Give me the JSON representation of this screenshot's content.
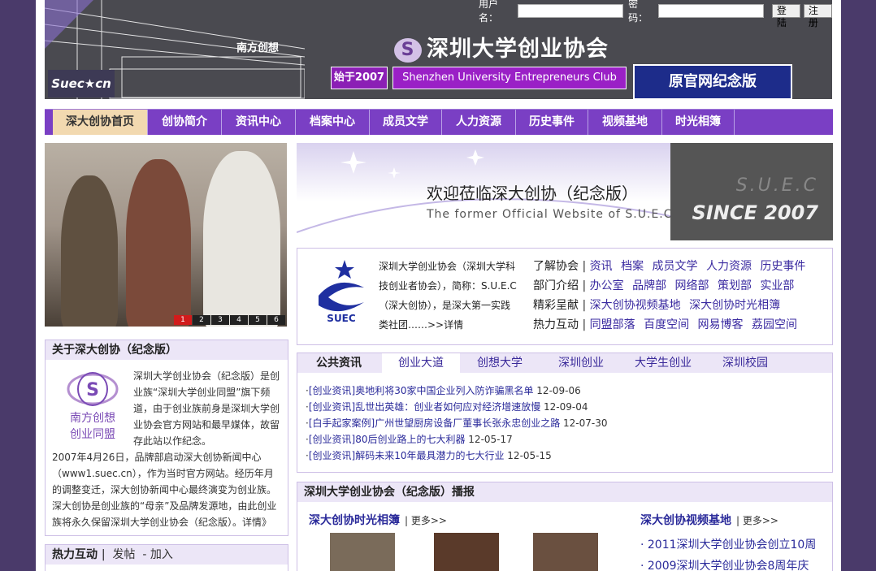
{
  "header": {
    "login_user_label": "用户名：",
    "login_pass_label": "密码：",
    "login_button": "登陆",
    "register_button": "注册",
    "logo_text": "Suec★cn",
    "nanfang_label": "南方创想",
    "site_title": "深圳大学创业协会",
    "since_badge": "始于2007",
    "subtitle_en": "Shenzhen University Entrepreneurs Club",
    "memorial_badge": "原官网纪念版"
  },
  "nav": [
    {
      "label": "深大创协首页",
      "active": true
    },
    {
      "label": "创协简介"
    },
    {
      "label": "资讯中心"
    },
    {
      "label": "档案中心"
    },
    {
      "label": "成员文学"
    },
    {
      "label": "人力资源"
    },
    {
      "label": "历史事件"
    },
    {
      "label": "视频基地"
    },
    {
      "label": "时光相簿"
    }
  ],
  "slideshow": {
    "pages": [
      "1",
      "2",
      "3",
      "4",
      "5",
      "6"
    ],
    "active": "1"
  },
  "banner": {
    "title": "欢迎莅临深大创协（纪念版）",
    "subtitle_en": "The former Official Website of S.U.E.C",
    "suec": "S.U.E.C",
    "since": "SINCE 2007"
  },
  "intro": {
    "text": "深圳大学创业协会（深圳大学科技创业者协会），简称：S.U.E.C（深大创协），是深大第一实践类社团……>>详情",
    "rows": [
      {
        "label": "了解协会",
        "links": [
          "资讯",
          "档案",
          "成员文学",
          "人力资源",
          "历史事件"
        ]
      },
      {
        "label": "部门介绍",
        "links": [
          "办公室",
          "品牌部",
          "网络部",
          "策划部",
          "实业部"
        ]
      },
      {
        "label": "精彩呈献",
        "links": [
          "深大创协视频基地",
          "深大创协时光相簿"
        ]
      },
      {
        "label": "热力互动",
        "links": [
          "同盟部落",
          "百度空间",
          "网易博客",
          "荔园空间"
        ]
      }
    ]
  },
  "news": {
    "tabs": [
      "公共资讯",
      "创业大道",
      "创想大学",
      "深圳创业",
      "大学生创业",
      "深圳校园"
    ],
    "active_tab": "创业大道",
    "items": [
      {
        "title": "[创业资讯]奥地利将30家中国企业列入防诈骗黑名单",
        "date": "12-09-06"
      },
      {
        "title": "[创业资讯]乱世出英雄：创业者如何应对经济增速放慢",
        "date": "12-09-04"
      },
      {
        "title": "[白手起家案例]广州世望厨房设备厂董事长张永忠创业之路",
        "date": "12-07-30"
      },
      {
        "title": "[创业资讯]80后创业路上的七大利器",
        "date": "12-05-17"
      },
      {
        "title": "[创业资讯]解码未来10年最具潜力的七大行业",
        "date": "12-05-15"
      }
    ]
  },
  "about": {
    "header": "关于深大创协（纪念版）",
    "logo_line1": "南方创想",
    "logo_line2": "创业同盟",
    "text_part1": "深圳大学创业协会（纪念版）是创业族“深圳大学创业同盟”旗下频道，由于创业族前身是深圳大学创业协会官方网站和最早媒体，故留存此站以作纪念。",
    "text_part2": "2007年4月26日，品牌部启动深大创协新闻中心（www1.suec.cn），作为当时官方网站。经历年月的调整变迁，深大创协新闻中心最终演变为创业族。深大创协是创业族的“母亲”及品牌发源地，由此创业族将永久保留深圳大学创业协会（纪念版）。详情》"
  },
  "interaction": {
    "header": "热力互动",
    "post": "发帖",
    "join": "- 加入"
  },
  "broadcast": {
    "header": "深圳大学创业协会（纪念版）播报",
    "album_title": "深大创协时光相簿",
    "video_title": "深大创协视频基地",
    "more": "| 更多>>",
    "videos": [
      "· 2011深圳大学创业协会创立10周",
      "· 2009深圳大学创业协会8周年庆"
    ]
  },
  "colors": {
    "nav_bg": "#7a3fc4",
    "nav_active_bg": "#f2d9b0",
    "header_bg": "#4a4a50",
    "link": "#3a2aa0"
  }
}
